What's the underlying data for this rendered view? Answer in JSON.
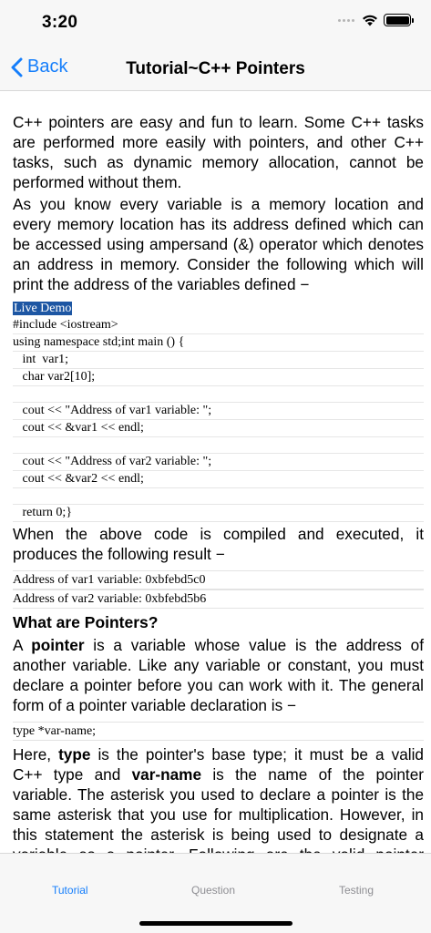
{
  "status": {
    "time": "3:20"
  },
  "nav": {
    "back_label": "Back",
    "title": "Tutorial~C++ Pointers"
  },
  "content": {
    "intro_1": "C++ pointers are easy and fun to learn. Some C++ tasks are performed more easily with pointers, and other C++ tasks, such as dynamic memory allocation, cannot be performed without them.",
    "intro_2": "As you know every variable is a memory location and every memory location has its address defined which can be accessed using ampersand (&) operator which denotes an address in memory. Consider the following which will print the address of the variables defined −",
    "live_demo": "Live Demo",
    "code_lines": [
      "#include <iostream>",
      "using namespace std;int main () {",
      "   int  var1;",
      "   char var2[10];",
      "",
      "   cout << \"Address of var1 variable: \";",
      "   cout << &var1 << endl;",
      "",
      "   cout << \"Address of var2 variable: \";",
      "   cout << &var2 << endl;",
      "",
      "   return 0;}"
    ],
    "result_intro": "When the above code is compiled and executed, it produces the following result −",
    "result_lines": [
      "Address of var1 variable: 0xbfebd5c0",
      "Address of var2 variable: 0xbfebd5b6"
    ],
    "heading": "What are Pointers?",
    "pointer_para": {
      "pre": "A ",
      "bold": "pointer",
      "post": " is a variable whose value is the address of another variable. Like any variable or constant, you must declare a pointer before you can work with it. The general form of a pointer variable declaration is −"
    },
    "declaration": "type *var-name;",
    "here_para": {
      "p1": "Here, ",
      "b1": "type",
      "p2": " is the pointer's base type; it must be a valid C++ type and ",
      "b2": "var-name",
      "p3": " is the name of the pointer variable. The asterisk you used to declare a pointer is the same asterisk that you use for multiplication. However, in this statement the asterisk is being used to designate a variable as a pointer. Following are the valid pointer declaration −"
    }
  },
  "tabs": [
    {
      "label": "Tutorial",
      "active": true
    },
    {
      "label": "Question",
      "active": false
    },
    {
      "label": "Testing",
      "active": false
    }
  ],
  "colors": {
    "accent": "#157efb",
    "highlight": "#1d56a3",
    "bar_background": "#f7f7f7"
  }
}
